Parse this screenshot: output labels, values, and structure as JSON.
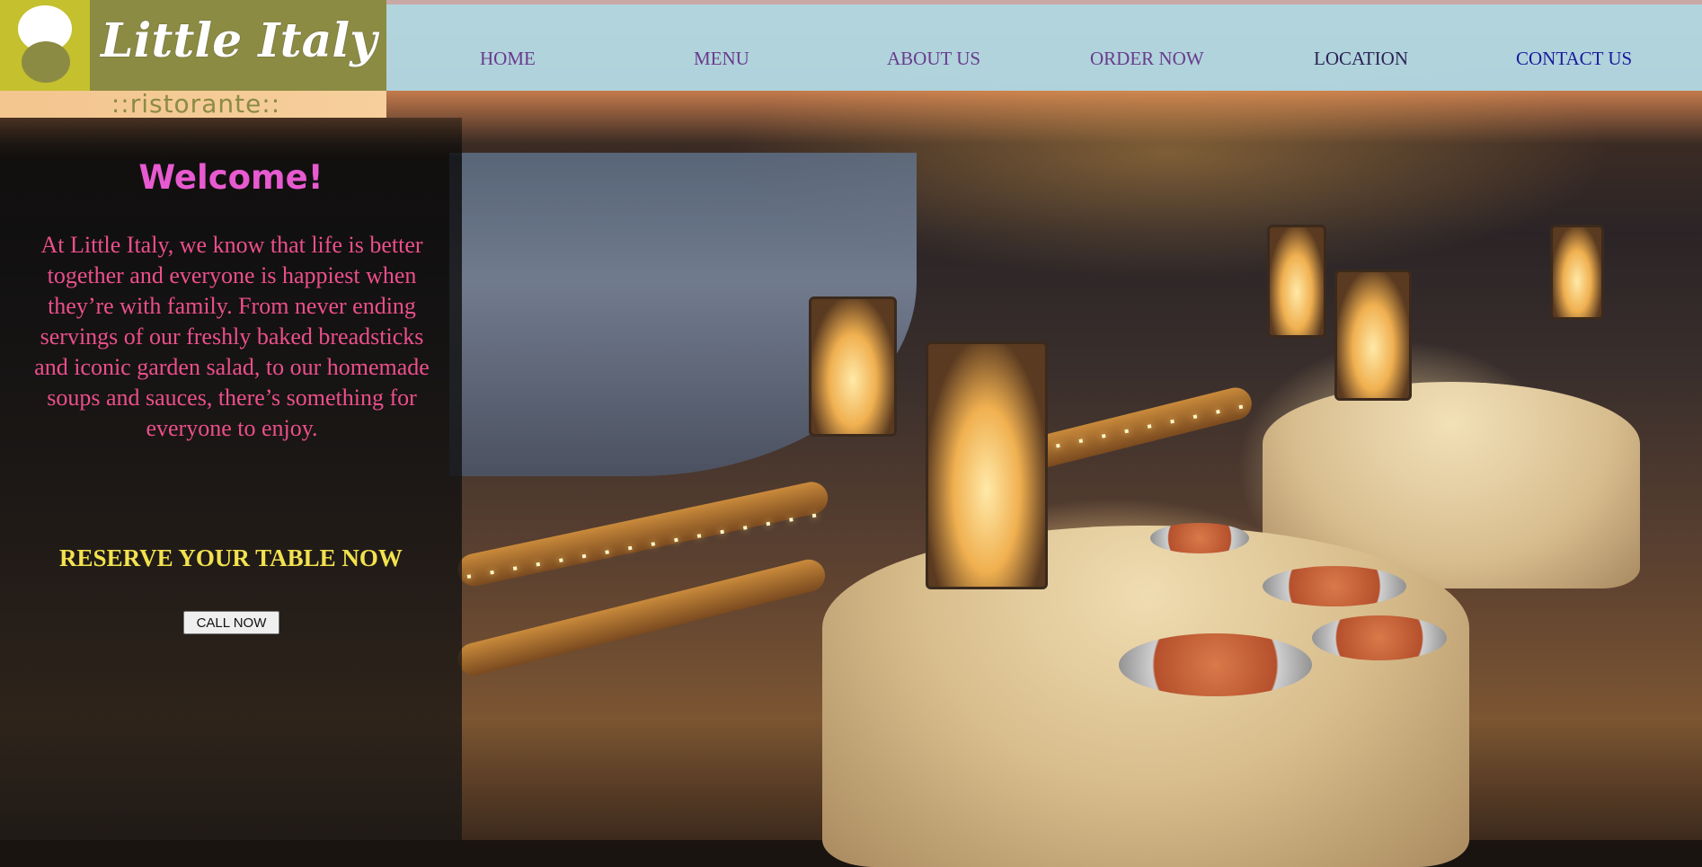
{
  "brand": {
    "logo_text": "Little Italy",
    "subtitle": "::ristorante::",
    "logo_color": "#8b8b43",
    "logo_accent": "#c4c02e"
  },
  "nav": {
    "items": [
      {
        "label": "HOME"
      },
      {
        "label": "MENU"
      },
      {
        "label": "ABOUT US"
      },
      {
        "label": "ORDER NOW"
      },
      {
        "label": "LOCATION"
      },
      {
        "label": "CONTACT US"
      }
    ],
    "bar_color": "#add8e6"
  },
  "welcome_panel": {
    "heading": "Welcome!",
    "intro": "At Little Italy, we know that life is better together and everyone is happiest when they’re with family. From never ending servings of our freshly baked breadsticks and iconic garden salad, to our homemade soups and sauces, there’s something for everyone to enjoy.",
    "reserve_heading": "RESERVE YOUR TABLE NOW",
    "call_button": "CALL NOW",
    "heading_color": "#e85ad0",
    "text_color": "#ec4f8b",
    "reserve_color": "#f2e24e"
  },
  "background": {
    "icon": "beach-dining-photo"
  }
}
